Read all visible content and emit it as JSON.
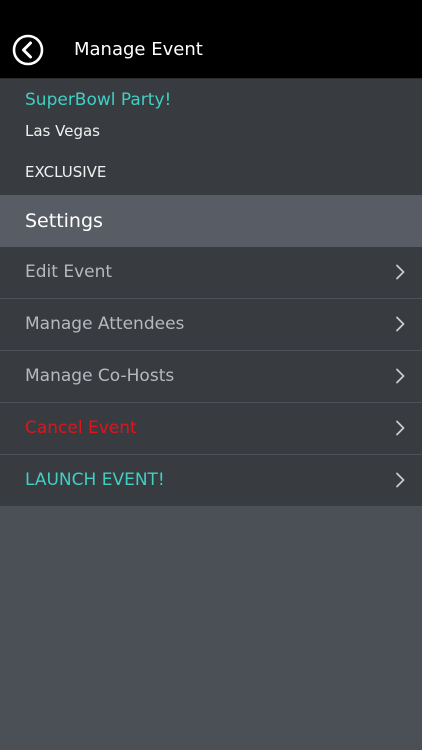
{
  "header": {
    "title": "Manage Event"
  },
  "event": {
    "name": "SuperBowl Party!",
    "location": "Las Vegas",
    "type": "EXCLUSIVE"
  },
  "settings": {
    "title": "Settings",
    "items": [
      {
        "label": "Edit Event",
        "color": "#b6b9be"
      },
      {
        "label": "Manage Attendees",
        "color": "#b6b9be"
      },
      {
        "label": "Manage Co-Hosts",
        "color": "#b6b9be"
      },
      {
        "label": "Cancel Event",
        "color": "#e0141b"
      },
      {
        "label": "LAUNCH EVENT!",
        "color": "#3fd0c4"
      }
    ]
  },
  "colors": {
    "accent": "#3fd0c4",
    "danger": "#e0141b",
    "header_bg": "#000000",
    "panel_bg": "#383b40",
    "section_bg": "#585c64",
    "page_bg": "#4b4f56"
  },
  "icons": {
    "back": "back-arrow-icon",
    "chevron": "chevron-right-icon"
  }
}
